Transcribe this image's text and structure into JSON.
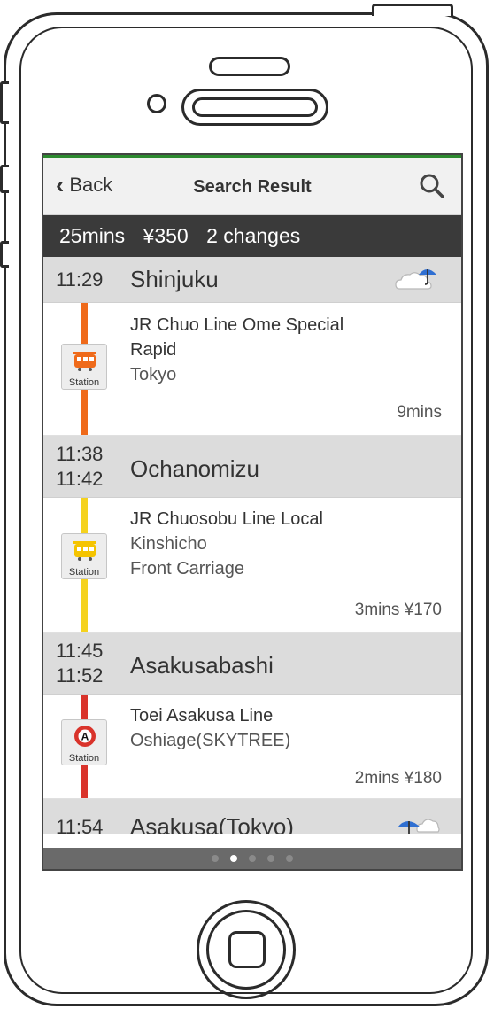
{
  "nav": {
    "back_label": "Back",
    "title": "Search Result"
  },
  "summary": {
    "duration": "25mins",
    "fare": "¥350",
    "changes": "2 changes"
  },
  "stops": [
    {
      "time_arr": "11:29",
      "time_dep": "",
      "name": "Shinjuku",
      "weather": "cloud-rain-umbrella-icon"
    },
    {
      "time_arr": "11:38",
      "time_dep": "11:42",
      "name": "Ochanomizu"
    },
    {
      "time_arr": "11:45",
      "time_dep": "11:52",
      "name": "Asakusabashi"
    },
    {
      "time_arr": "11:54",
      "time_dep": "",
      "name": "Asakusa(Tokyo)",
      "weather": "umbrella-cloud-icon"
    }
  ],
  "legs": [
    {
      "line": "JR Chuo Line Ome Special Rapid",
      "line_wrapped": [
        "JR Chuo Line Ome Special",
        "Rapid"
      ],
      "destination": "Tokyo",
      "extra": "",
      "duration": "9mins",
      "fare": "",
      "color": "#ef6a1a",
      "icon": "train-icon",
      "badge_label": "Station"
    },
    {
      "line": "JR Chuosobu Line Local",
      "destination": "Kinshicho",
      "extra": "Front Carriage",
      "duration": "3mins",
      "fare": "¥170",
      "color": "#f5d21e",
      "icon": "train-icon",
      "badge_label": "Station"
    },
    {
      "line": "Toei Asakusa Line",
      "destination": "Oshiage(SKYTREE)",
      "extra": "",
      "duration": "2mins",
      "fare": "¥180",
      "color": "#d9332b",
      "icon": "subway-a-icon",
      "icon_letter": "A",
      "badge_label": "Station"
    }
  ],
  "pager": {
    "count": 5,
    "active_index": 1
  },
  "colors": {
    "header_accent": "#2c8a2f",
    "summary_bg": "#3a3a3a",
    "stop_bg": "#dcdcdc"
  }
}
